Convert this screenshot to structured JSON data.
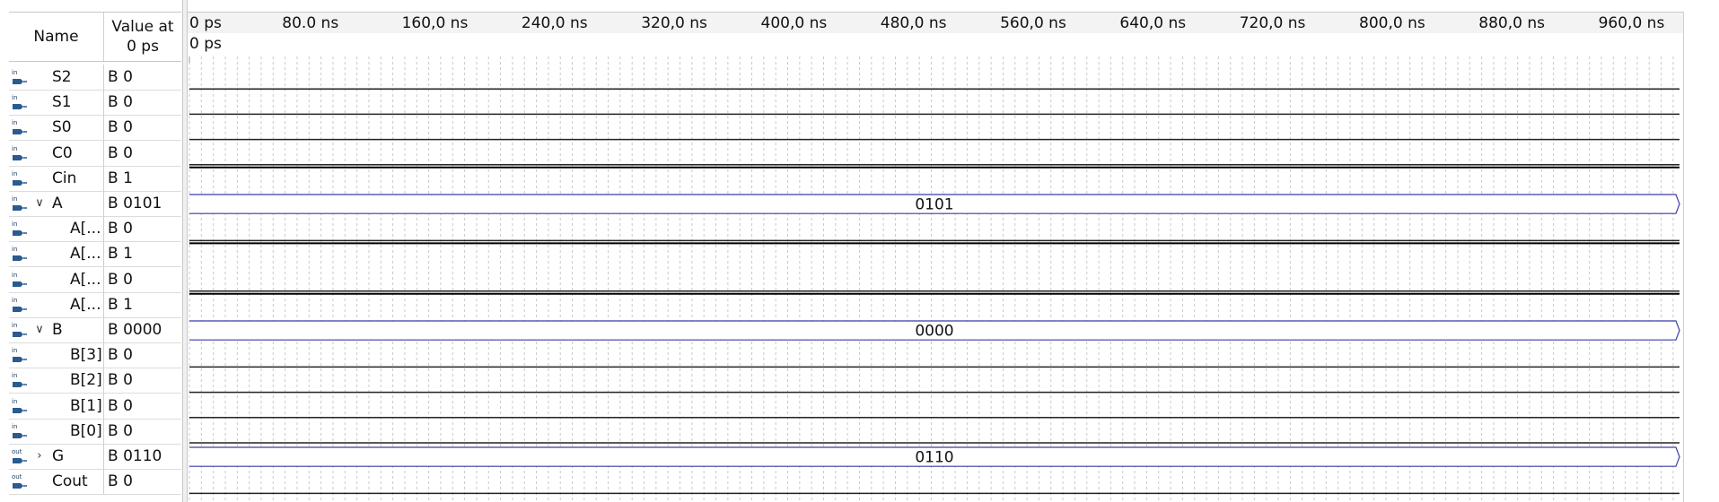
{
  "header": {
    "name_col": "Name",
    "value_col_line1": "Value at",
    "value_col_line2": "0 ps"
  },
  "timeline": {
    "labels": [
      "0 ps",
      "80.0 ns",
      "160,0 ns",
      "240,0 ns",
      "320,0 ns",
      "400,0 ns",
      "480,0 ns",
      "560,0 ns",
      "640,0 ns",
      "720,0 ns",
      "800,0 ns",
      "880,0 ns",
      "960,0 ns"
    ],
    "cursor_label": "0 ps"
  },
  "signals": [
    {
      "name": "S2",
      "value": "B 0",
      "direction": "in",
      "indent": 0,
      "expander": "",
      "wave": "low"
    },
    {
      "name": "S1",
      "value": "B 0",
      "direction": "in",
      "indent": 0,
      "expander": "",
      "wave": "low"
    },
    {
      "name": "S0",
      "value": "B 0",
      "direction": "in",
      "indent": 0,
      "expander": "",
      "wave": "low"
    },
    {
      "name": "C0",
      "value": "B 0",
      "direction": "in",
      "indent": 0,
      "expander": "",
      "wave": "low"
    },
    {
      "name": "Cin",
      "value": "B 1",
      "direction": "in",
      "indent": 0,
      "expander": "",
      "wave": "high"
    },
    {
      "name": "A",
      "value": "B 0101",
      "direction": "in",
      "indent": 0,
      "expander": "open",
      "wave": "bus",
      "bus_value": "0101"
    },
    {
      "name": "A[...",
      "value": "B 0",
      "direction": "in",
      "indent": 1,
      "expander": "",
      "wave": "low"
    },
    {
      "name": "A[...",
      "value": "B 1",
      "direction": "in",
      "indent": 1,
      "expander": "",
      "wave": "high"
    },
    {
      "name": "A[...",
      "value": "B 0",
      "direction": "in",
      "indent": 1,
      "expander": "",
      "wave": "low"
    },
    {
      "name": "A[...",
      "value": "B 1",
      "direction": "in",
      "indent": 1,
      "expander": "",
      "wave": "high"
    },
    {
      "name": "B",
      "value": "B 0000",
      "direction": "in",
      "indent": 0,
      "expander": "open",
      "wave": "bus",
      "bus_value": "0000"
    },
    {
      "name": "B[3]",
      "value": "B 0",
      "direction": "in",
      "indent": 1,
      "expander": "",
      "wave": "low"
    },
    {
      "name": "B[2]",
      "value": "B 0",
      "direction": "in",
      "indent": 1,
      "expander": "",
      "wave": "low"
    },
    {
      "name": "B[1]",
      "value": "B 0",
      "direction": "in",
      "indent": 1,
      "expander": "",
      "wave": "low"
    },
    {
      "name": "B[0]",
      "value": "B 0",
      "direction": "in",
      "indent": 1,
      "expander": "",
      "wave": "low"
    },
    {
      "name": "G",
      "value": "B 0110",
      "direction": "out",
      "indent": 0,
      "expander": "closed",
      "wave": "bus",
      "bus_value": "0110"
    },
    {
      "name": "Cout",
      "value": "B 0",
      "direction": "out",
      "indent": 0,
      "expander": "",
      "wave": "low"
    }
  ],
  "colors": {
    "bus": "#3a3aa8",
    "wave": "#222222",
    "grid": "#c9c9c9",
    "icon_in": "#2a5b8f"
  }
}
